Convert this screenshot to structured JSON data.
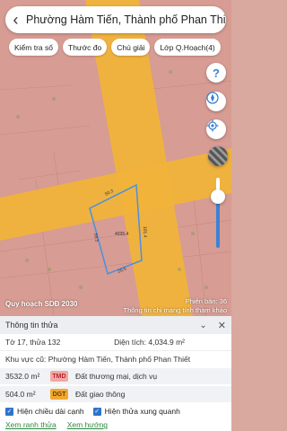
{
  "search": {
    "title": "Phường Hàm Tiến, Thành phố Phan Thiết"
  },
  "chips": [
    {
      "label": "Kiểm tra số"
    },
    {
      "label": "Thước đo"
    },
    {
      "label": "Chú giải"
    },
    {
      "label": "Lớp Q.Hoạch(4)"
    }
  ],
  "map": {
    "help_glyph": "?",
    "caption": "Quy hoạch SDĐ 2030",
    "version": "Phiên bản: 36",
    "disclaimer": "Thông tin chỉ mang tính tham khảo",
    "opacity_fraction": 0.75,
    "colors": {
      "base": "#d79c93",
      "road": "#f0b33a",
      "parcel_outline": "#4a90e2"
    },
    "parcel_dims": {
      "top": "50.3",
      "right": "101.4",
      "left": "59.5",
      "bottom": "20.5",
      "area": "4035.4"
    }
  },
  "panel": {
    "title": "Thông tin thửa",
    "parcel": "Tờ 17, thửa 132",
    "area_label": "Diện tích: 4,034.9 m²",
    "old_area": "Khu vực cũ: Phường Hàm Tiến, Thành phố Phan Thiết",
    "zones": [
      {
        "area": "3532.0 m²",
        "code": "TMD",
        "name": "Đất thương mại, dịch vụ"
      },
      {
        "area": "504.0 m²",
        "code": "DGT",
        "name": "Đất giao thông"
      }
    ],
    "checks": [
      {
        "label": "Hiện chiều dài cạnh"
      },
      {
        "label": "Hiện thửa xung quanh"
      }
    ],
    "links": [
      {
        "label": "Xem ranh thửa"
      },
      {
        "label": "Xem hướng"
      }
    ]
  }
}
